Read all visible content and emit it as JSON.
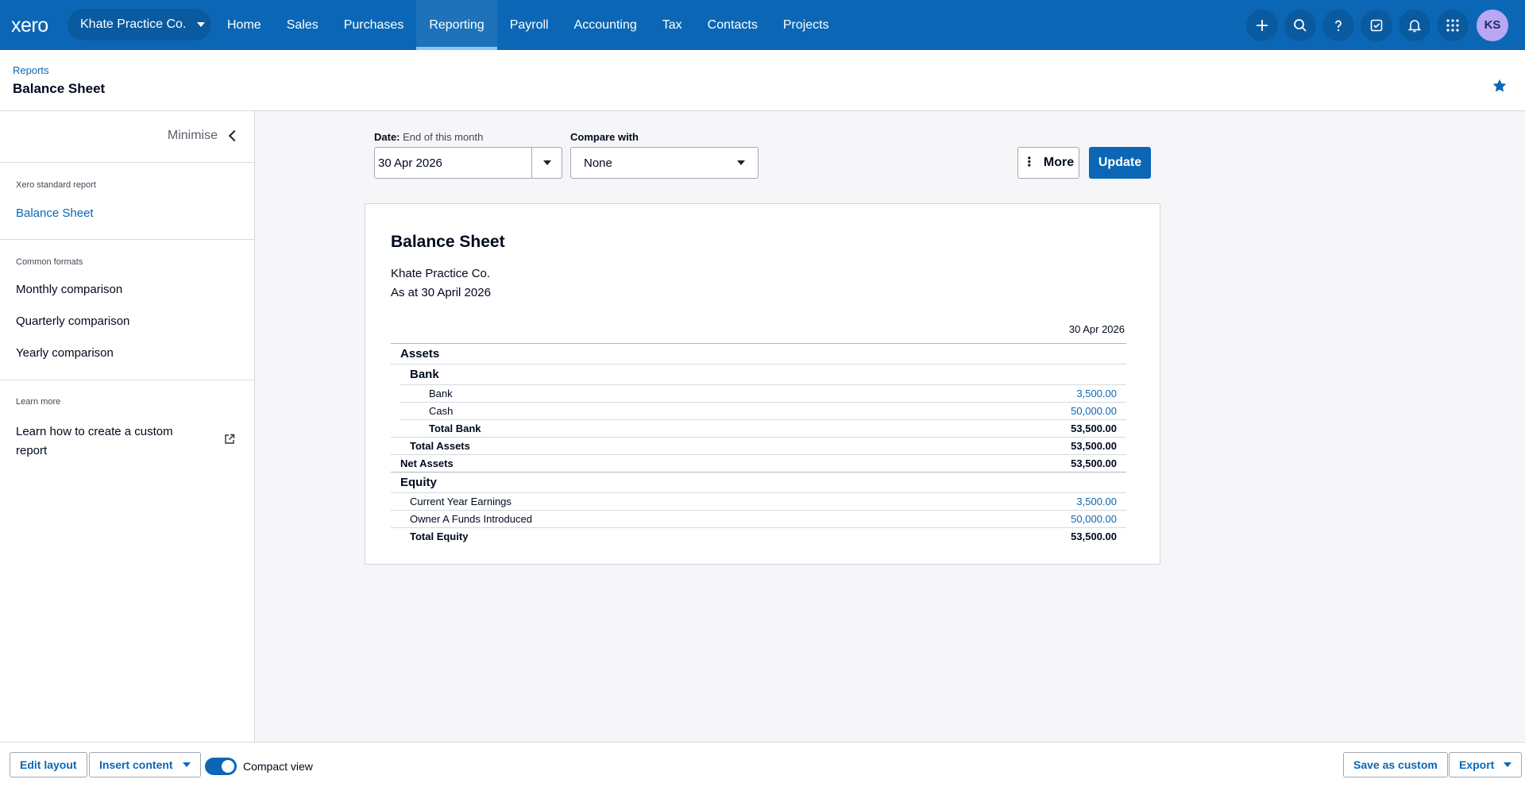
{
  "nav": {
    "logo": "xero",
    "org": "Khate Practice Co.",
    "items": [
      "Home",
      "Sales",
      "Purchases",
      "Reporting",
      "Payroll",
      "Accounting",
      "Tax",
      "Contacts",
      "Projects"
    ],
    "active": "Reporting",
    "icons": [
      "plus-icon",
      "search-icon",
      "help-icon",
      "tasks-icon",
      "bell-icon",
      "apps-grid-icon"
    ],
    "avatar_initials": "KS"
  },
  "header": {
    "breadcrumb": "Reports",
    "title": "Balance Sheet"
  },
  "sidebar": {
    "minimise": "Minimise",
    "standard_heading": "Xero standard report",
    "standard_link": "Balance Sheet",
    "formats_heading": "Common formats",
    "formats": [
      "Monthly comparison",
      "Quarterly comparison",
      "Yearly comparison"
    ],
    "learn_heading": "Learn more",
    "learn_link_line1": "Learn how to create a custom",
    "learn_link_line2": "report"
  },
  "controls": {
    "date_label": "Date:",
    "date_hint": "End of this month",
    "date_value": "30 Apr 2026",
    "compare_label": "Compare with",
    "compare_value": "None",
    "more": "More",
    "update": "Update"
  },
  "report": {
    "title": "Balance Sheet",
    "company": "Khate Practice Co.",
    "as_at": "As at 30 April 2026",
    "column": "30 Apr 2026",
    "rows": [
      {
        "label": "Assets",
        "value": "",
        "kind": "section",
        "indent": 0
      },
      {
        "label": "Bank",
        "value": "",
        "kind": "subsection",
        "indent": 1
      },
      {
        "label": "Bank",
        "value": "3,500.00",
        "kind": "line",
        "indent": 2
      },
      {
        "label": "Cash",
        "value": "50,000.00",
        "kind": "line",
        "indent": 2
      },
      {
        "label": "Total Bank",
        "value": "53,500.00",
        "kind": "total",
        "indent": 2
      },
      {
        "label": "Total Assets",
        "value": "53,500.00",
        "kind": "total",
        "indent": 1
      },
      {
        "label": "Net Assets",
        "value": "53,500.00",
        "kind": "total",
        "indent": 0
      },
      {
        "label": "Equity",
        "value": "",
        "kind": "section",
        "indent": 0
      },
      {
        "label": "Current Year Earnings",
        "value": "3,500.00",
        "kind": "line",
        "indent": 1
      },
      {
        "label": "Owner A Funds Introduced",
        "value": "50,000.00",
        "kind": "line",
        "indent": 1
      },
      {
        "label": "Total Equity",
        "value": "53,500.00",
        "kind": "total",
        "indent": 1
      }
    ]
  },
  "footer": {
    "edit_layout": "Edit layout",
    "insert_content": "Insert content",
    "compact_view": "Compact view",
    "compact_on": true,
    "save_as_custom": "Save as custom",
    "export": "Export"
  }
}
